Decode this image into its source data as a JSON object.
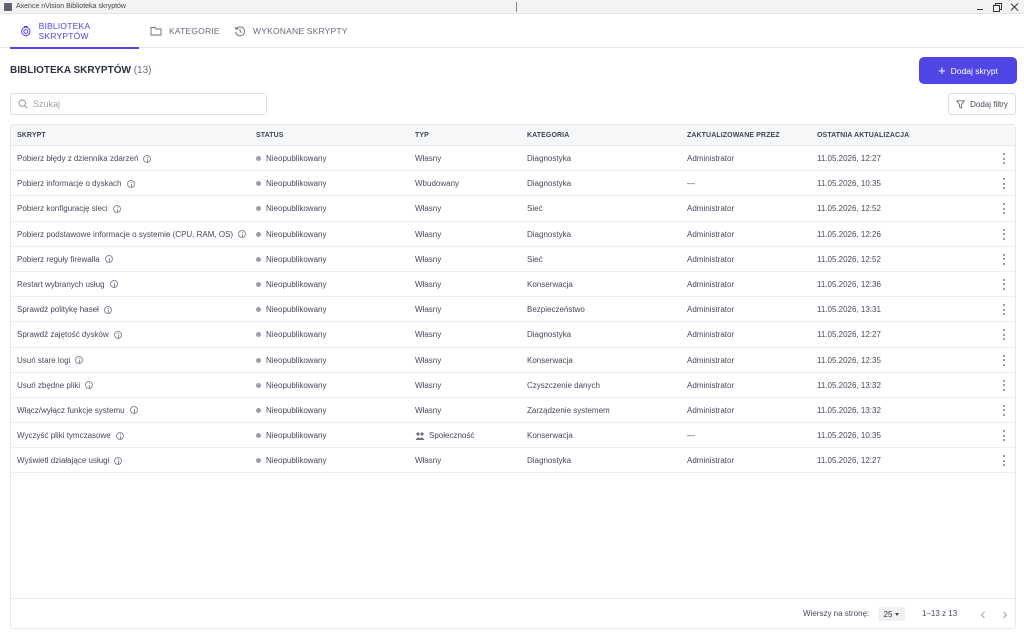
{
  "window": {
    "title": "Axence nVision Biblioteka skryptów"
  },
  "tabs": [
    {
      "label": "BIBLIOTEKA SKRYPTÓW",
      "icon": "library-icon"
    },
    {
      "label": "KATEGORIE",
      "icon": "folder-icon"
    },
    {
      "label": "WYKONANE SKRYPTY",
      "icon": "history-icon"
    }
  ],
  "header": {
    "title": "BIBLIOTEKA SKRYPTÓW",
    "count": "(13)",
    "add_button": "Dodaj skrypt"
  },
  "search": {
    "placeholder": "Szukaj"
  },
  "filter": {
    "label": "Dodaj filtry"
  },
  "table": {
    "columns": [
      "SKRYPT",
      "STATUS",
      "TYP",
      "KATEGORIA",
      "ZAKTUALIZOWANE PRZEZ",
      "OSTATNIA AKTUALIZACJA"
    ],
    "rows": [
      {
        "name": "Pobierz błędy z dziennika zdarzeń",
        "status": "Nieopublikowany",
        "type": "Własny",
        "category": "Diagnostyka",
        "updated_by": "Administrator",
        "updated_at": "11.05.2026, 12:27"
      },
      {
        "name": "Pobierz informacje o dyskach",
        "status": "Nieopublikowany",
        "type": "Wbudowany",
        "category": "Diagnostyka",
        "updated_by": "—",
        "updated_at": "11.05.2026, 10:35"
      },
      {
        "name": "Pobierz konfigurację sieci",
        "status": "Nieopublikowany",
        "type": "Własny",
        "category": "Sieć",
        "updated_by": "Administrator",
        "updated_at": "11.05.2026, 12:52"
      },
      {
        "name": "Pobierz podstawowe informacje o systemie (CPU, RAM, OS)",
        "status": "Nieopublikowany",
        "type": "Własny",
        "category": "Diagnostyka",
        "updated_by": "Administrator",
        "updated_at": "11.05.2026, 12:26"
      },
      {
        "name": "Pobierz reguły firewalla",
        "status": "Nieopublikowany",
        "type": "Własny",
        "category": "Sieć",
        "updated_by": "Administrator",
        "updated_at": "11.05.2026, 12:52"
      },
      {
        "name": "Restart wybranych usług",
        "status": "Nieopublikowany",
        "type": "Własny",
        "category": "Konserwacja",
        "updated_by": "Administrator",
        "updated_at": "11.05.2026, 12:36"
      },
      {
        "name": "Sprawdź politykę haseł",
        "status": "Nieopublikowany",
        "type": "Własny",
        "category": "Bezpieczeństwo",
        "updated_by": "Administrator",
        "updated_at": "11.05.2026, 13:31"
      },
      {
        "name": "Sprawdź zajętość dysków",
        "status": "Nieopublikowany",
        "type": "Własny",
        "category": "Diagnostyka",
        "updated_by": "Administrator",
        "updated_at": "11.05.2026, 12:27"
      },
      {
        "name": "Usuń stare logi",
        "status": "Nieopublikowany",
        "type": "Własny",
        "category": "Konserwacja",
        "updated_by": "Administrator",
        "updated_at": "11.05.2026, 12:35"
      },
      {
        "name": "Usuń zbędne pliki",
        "status": "Nieopublikowany",
        "type": "Własny",
        "category": "Czyszczenie danych",
        "updated_by": "Administrator",
        "updated_at": "11.05.2026, 13:32"
      },
      {
        "name": "Włącz/wyłącz funkcje systemu",
        "status": "Nieopublikowany",
        "type": "Własny",
        "category": "Zarządzenie systemem",
        "updated_by": "Administrator",
        "updated_at": "11.05.2026, 13:32"
      },
      {
        "name": "Wyczyść pliki tymczasowe",
        "status": "Nieopublikowany",
        "type": "Społeczność",
        "category": "Konserwacja",
        "updated_by": "—",
        "updated_at": "11.05.2026, 10:35"
      },
      {
        "name": "Wyświetl działające usługi",
        "status": "Nieopublikowany",
        "type": "Własny",
        "category": "Diagnostyka",
        "updated_by": "Administrator",
        "updated_at": "11.05.2026, 12:27"
      }
    ]
  },
  "pagination": {
    "rows_per_page_label": "Wierszy na stronę:",
    "rows_per_page": "25",
    "range": "1–13 z 13"
  },
  "colors": {
    "accent": "#4f46e5",
    "status_dot": "#9aa0ab"
  }
}
